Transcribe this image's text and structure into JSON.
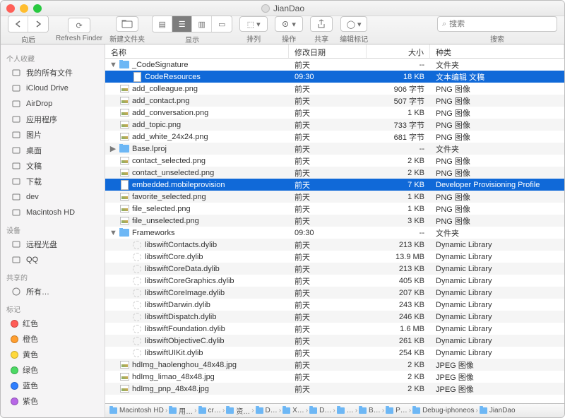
{
  "window_title": "JianDao",
  "toolbar": {
    "nav_label": "向后",
    "refresh_label": "Refresh Finder",
    "newfolder_label": "新建文件夹",
    "view_label": "显示",
    "arrange_label": "排列",
    "action_label": "操作",
    "share_label": "共享",
    "tags_label": "编辑标记",
    "search_label": "搜索",
    "search_placeholder": "搜索"
  },
  "sidebar": {
    "favorites_label": "个人收藏",
    "favorites": [
      "我的所有文件",
      "iCloud Drive",
      "AirDrop",
      "应用程序",
      "图片",
      "桌面",
      "文稿",
      "下载",
      "dev",
      "Macintosh HD"
    ],
    "devices_label": "设备",
    "devices": [
      "远程光盘",
      "QQ"
    ],
    "shared_label": "共享的",
    "shared": [
      "所有…"
    ],
    "tags_label": "标记",
    "tags": [
      {
        "label": "红色",
        "color": "#ff5b55"
      },
      {
        "label": "橙色",
        "color": "#ff9e2f"
      },
      {
        "label": "黄色",
        "color": "#ffd93b"
      },
      {
        "label": "绿色",
        "color": "#4cd964"
      },
      {
        "label": "蓝色",
        "color": "#2f7fff"
      },
      {
        "label": "紫色",
        "color": "#b767e6"
      }
    ]
  },
  "columns": {
    "name": "名称",
    "date": "修改日期",
    "size": "大小",
    "kind": "种类"
  },
  "files": [
    {
      "indent": 0,
      "disc": "▼",
      "icon": "folder",
      "name": "_CodeSignature",
      "date": "前天",
      "size": "--",
      "kind": "文件夹",
      "sel": false
    },
    {
      "indent": 1,
      "disc": "",
      "icon": "doc",
      "name": "CodeResources",
      "date": "09:30",
      "size": "18 KB",
      "kind": "文本编辑 文稿",
      "sel": true
    },
    {
      "indent": 0,
      "disc": "",
      "icon": "img",
      "name": "add_colleague.png",
      "date": "前天",
      "size": "906 字节",
      "kind": "PNG 图像",
      "sel": false
    },
    {
      "indent": 0,
      "disc": "",
      "icon": "img",
      "name": "add_contact.png",
      "date": "前天",
      "size": "507 字节",
      "kind": "PNG 图像",
      "sel": false
    },
    {
      "indent": 0,
      "disc": "",
      "icon": "img",
      "name": "add_conversation.png",
      "date": "前天",
      "size": "1 KB",
      "kind": "PNG 图像",
      "sel": false
    },
    {
      "indent": 0,
      "disc": "",
      "icon": "img",
      "name": "add_topic.png",
      "date": "前天",
      "size": "733 字节",
      "kind": "PNG 图像",
      "sel": false
    },
    {
      "indent": 0,
      "disc": "",
      "icon": "img",
      "name": "add_white_24x24.png",
      "date": "前天",
      "size": "681 字节",
      "kind": "PNG 图像",
      "sel": false
    },
    {
      "indent": 0,
      "disc": "▶",
      "icon": "folder",
      "name": "Base.lproj",
      "date": "前天",
      "size": "--",
      "kind": "文件夹",
      "sel": false
    },
    {
      "indent": 0,
      "disc": "",
      "icon": "img",
      "name": "contact_selected.png",
      "date": "前天",
      "size": "2 KB",
      "kind": "PNG 图像",
      "sel": false
    },
    {
      "indent": 0,
      "disc": "",
      "icon": "img",
      "name": "contact_unselected.png",
      "date": "前天",
      "size": "2 KB",
      "kind": "PNG 图像",
      "sel": false
    },
    {
      "indent": 0,
      "disc": "",
      "icon": "doc",
      "name": "embedded.mobileprovision",
      "date": "前天",
      "size": "7 KB",
      "kind": "Developer Provisioning Profile",
      "sel": true
    },
    {
      "indent": 0,
      "disc": "",
      "icon": "img",
      "name": "favorite_selected.png",
      "date": "前天",
      "size": "1 KB",
      "kind": "PNG 图像",
      "sel": false
    },
    {
      "indent": 0,
      "disc": "",
      "icon": "img",
      "name": "file_selected.png",
      "date": "前天",
      "size": "1 KB",
      "kind": "PNG 图像",
      "sel": false
    },
    {
      "indent": 0,
      "disc": "",
      "icon": "img",
      "name": "file_unselected.png",
      "date": "前天",
      "size": "3 KB",
      "kind": "PNG 图像",
      "sel": false
    },
    {
      "indent": 0,
      "disc": "▼",
      "icon": "folder",
      "name": "Frameworks",
      "date": "09:30",
      "size": "--",
      "kind": "文件夹",
      "sel": false
    },
    {
      "indent": 1,
      "disc": "",
      "icon": "dyl",
      "name": "libswiftContacts.dylib",
      "date": "前天",
      "size": "213 KB",
      "kind": "Dynamic Library",
      "sel": false
    },
    {
      "indent": 1,
      "disc": "",
      "icon": "dyl",
      "name": "libswiftCore.dylib",
      "date": "前天",
      "size": "13.9 MB",
      "kind": "Dynamic Library",
      "sel": false
    },
    {
      "indent": 1,
      "disc": "",
      "icon": "dyl",
      "name": "libswiftCoreData.dylib",
      "date": "前天",
      "size": "213 KB",
      "kind": "Dynamic Library",
      "sel": false
    },
    {
      "indent": 1,
      "disc": "",
      "icon": "dyl",
      "name": "libswiftCoreGraphics.dylib",
      "date": "前天",
      "size": "405 KB",
      "kind": "Dynamic Library",
      "sel": false
    },
    {
      "indent": 1,
      "disc": "",
      "icon": "dyl",
      "name": "libswiftCoreImage.dylib",
      "date": "前天",
      "size": "207 KB",
      "kind": "Dynamic Library",
      "sel": false
    },
    {
      "indent": 1,
      "disc": "",
      "icon": "dyl",
      "name": "libswiftDarwin.dylib",
      "date": "前天",
      "size": "243 KB",
      "kind": "Dynamic Library",
      "sel": false
    },
    {
      "indent": 1,
      "disc": "",
      "icon": "dyl",
      "name": "libswiftDispatch.dylib",
      "date": "前天",
      "size": "246 KB",
      "kind": "Dynamic Library",
      "sel": false
    },
    {
      "indent": 1,
      "disc": "",
      "icon": "dyl",
      "name": "libswiftFoundation.dylib",
      "date": "前天",
      "size": "1.6 MB",
      "kind": "Dynamic Library",
      "sel": false
    },
    {
      "indent": 1,
      "disc": "",
      "icon": "dyl",
      "name": "libswiftObjectiveC.dylib",
      "date": "前天",
      "size": "261 KB",
      "kind": "Dynamic Library",
      "sel": false
    },
    {
      "indent": 1,
      "disc": "",
      "icon": "dyl",
      "name": "libswiftUIKit.dylib",
      "date": "前天",
      "size": "254 KB",
      "kind": "Dynamic Library",
      "sel": false
    },
    {
      "indent": 0,
      "disc": "",
      "icon": "img",
      "name": "hdImg_haolenghou_48x48.jpg",
      "date": "前天",
      "size": "2 KB",
      "kind": "JPEG 图像",
      "sel": false
    },
    {
      "indent": 0,
      "disc": "",
      "icon": "img",
      "name": "hdImg_limao_48x48.jpg",
      "date": "前天",
      "size": "2 KB",
      "kind": "JPEG 图像",
      "sel": false
    },
    {
      "indent": 0,
      "disc": "",
      "icon": "img",
      "name": "hdImg_pnp_48x48.jpg",
      "date": "前天",
      "size": "2 KB",
      "kind": "JPEG 图像",
      "sel": false
    }
  ],
  "path": [
    "Macintosh HD",
    "用…",
    "cr…",
    "资…",
    "D…",
    "X…",
    "D…",
    "…",
    "B…",
    "P…",
    "Debug-iphoneos",
    "JianDao"
  ]
}
